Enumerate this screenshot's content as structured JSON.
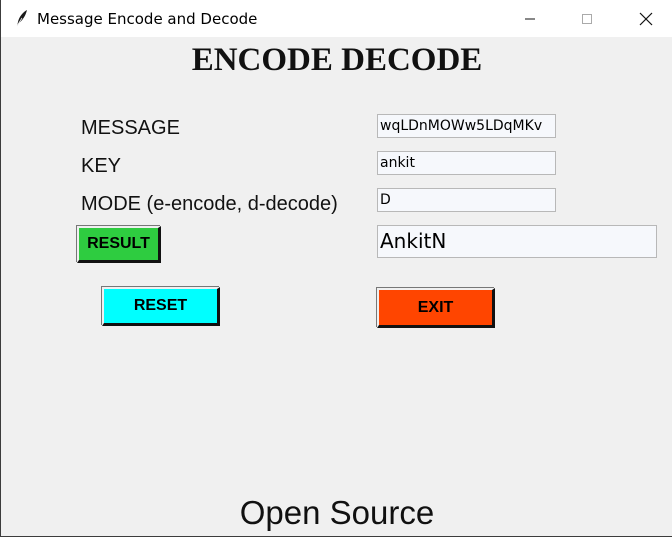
{
  "window": {
    "title": "Message Encode and Decode",
    "icon": "feather-icon"
  },
  "app": {
    "heading": "ENCODE DECODE",
    "labels": {
      "message": "MESSAGE",
      "key": "KEY",
      "mode": "MODE (e-encode, d-decode)"
    },
    "fields": {
      "message": "wqLDnMOWw5LDqMKv",
      "key": "ankit",
      "mode": "D",
      "result": "AnkitN"
    },
    "buttons": {
      "result": {
        "label": "RESULT",
        "color": "#2ecc40"
      },
      "reset": {
        "label": "RESET",
        "color": "#00ffff"
      },
      "exit": {
        "label": "EXIT",
        "color": "#ff4500"
      }
    },
    "footer": "Open Source"
  }
}
